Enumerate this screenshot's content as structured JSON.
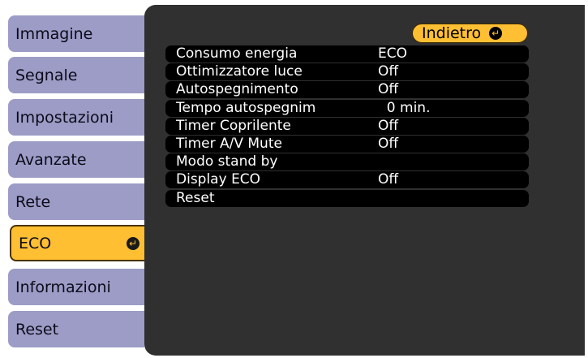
{
  "sidebar": {
    "items": [
      {
        "label": "Immagine",
        "active": false
      },
      {
        "label": "Segnale",
        "active": false
      },
      {
        "label": "Impostazioni",
        "active": false
      },
      {
        "label": "Avanzate",
        "active": false
      },
      {
        "label": "Rete",
        "active": false
      },
      {
        "label": "ECO",
        "active": true
      },
      {
        "label": "Informazioni",
        "active": false
      },
      {
        "label": "Reset",
        "active": false
      }
    ],
    "enter_icon": "enter-icon"
  },
  "panel": {
    "back_label": "Indietro",
    "back_icon": "enter-icon",
    "rows": [
      {
        "name": "Consumo energia",
        "value": "ECO"
      },
      {
        "name": "Ottimizzatore luce",
        "value": "Off"
      },
      {
        "name": "Autospegnimento",
        "value": "Off"
      },
      {
        "name": "Tempo autospegnim",
        "value": "  0 min."
      },
      {
        "name": "Timer Coprilente",
        "value": "Off"
      },
      {
        "name": "Timer A/V Mute",
        "value": "Off"
      },
      {
        "name": "Modo stand by",
        "value": ""
      },
      {
        "name": "Display ECO",
        "value": "Off"
      },
      {
        "name": "Reset",
        "value": ""
      }
    ]
  },
  "colors": {
    "sidebar_item": "#9c9cc6",
    "sidebar_active": "#ffbf33",
    "panel_bg": "#303030",
    "row_bg": "#000000",
    "back_button": "#ffbf33"
  }
}
